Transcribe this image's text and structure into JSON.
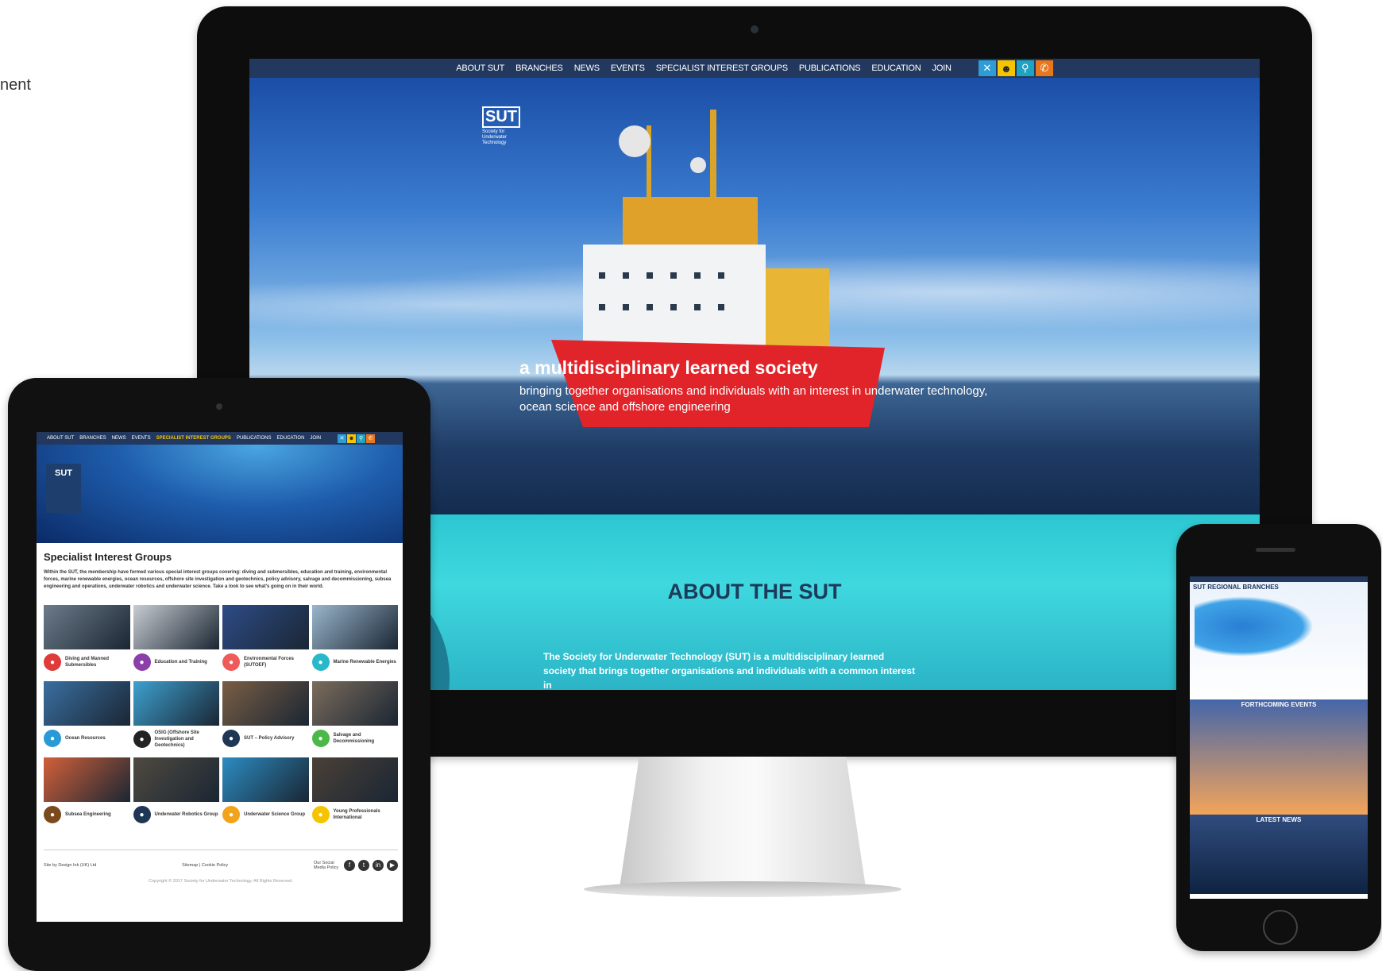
{
  "side_text": "nent",
  "imac": {
    "nav": [
      "ABOUT SUT",
      "BRANCHES",
      "NEWS",
      "EVENTS",
      "SPECIALIST INTEREST GROUPS",
      "PUBLICATIONS",
      "EDUCATION",
      "JOIN"
    ],
    "nav_icons": [
      {
        "name": "close-icon",
        "glyph": "✕",
        "color": "#2f9cd6"
      },
      {
        "name": "user-icon",
        "glyph": "👤",
        "color": "#f5c400"
      },
      {
        "name": "search-icon",
        "glyph": "🔍",
        "color": "#1fa3c2"
      },
      {
        "name": "phone-icon",
        "glyph": "✆",
        "color": "#e8771c"
      }
    ],
    "logo_mark": "SUT",
    "logo_tag": "Society for Underwater Technology",
    "hero_title": "a multidisciplinary learned society",
    "hero_sub": "bringing together organisations and individuals with an interest in underwater technology, ocean science and offshore engineering",
    "about_title": "ABOUT THE SUT",
    "about_text": "The Society for Underwater Technology (SUT) is a multidisciplinary learned society that brings together organisations and individuals with a common interest in"
  },
  "ipad": {
    "nav": [
      "ABOUT SUT",
      "BRANCHES",
      "NEWS",
      "EVENTS",
      "SPECIALIST INTEREST GROUPS",
      "PUBLICATIONS",
      "EDUCATION",
      "JOIN"
    ],
    "logo_mark": "SUT",
    "title": "Specialist Interest Groups",
    "intro": "Within the SUT, the membership have formed various special interest groups covering: diving and submersibles, education and training, environmental forces, marine renewable energies, ocean resources, offshore site investigation and geotechnics, policy advisory, salvage and decommissioning, subsea engineering and operations, underwater robotics and underwater science. Take a look to see what's going on in their world.",
    "groups": [
      {
        "label": "Diving and Manned Submersibles",
        "color": "#e03b3b",
        "thumb": "#6d7b8a"
      },
      {
        "label": "Education and Training",
        "color": "#8b3fa8",
        "thumb": "#c8ccd2"
      },
      {
        "label": "Environmental Forces (SUTOEF)",
        "color": "#ef5b5b",
        "thumb": "#2d4b86"
      },
      {
        "label": "Marine Renewable Energies",
        "color": "#29b8c9",
        "thumb": "#9ab6cc"
      },
      {
        "label": "Ocean Resources",
        "color": "#2a9ad6",
        "thumb": "#3a6fa1"
      },
      {
        "label": "OSIG (Offshore Site Investigation and Geotechnics)",
        "color": "#222222",
        "thumb": "#3ea0d0"
      },
      {
        "label": "SUT – Policy Advisory",
        "color": "#1f3655",
        "thumb": "#7a5e45"
      },
      {
        "label": "Salvage and Decommissioning",
        "color": "#4bb848",
        "thumb": "#7c6c5c"
      },
      {
        "label": "Subsea Engineering",
        "color": "#7a4a1e",
        "thumb": "#d2603a"
      },
      {
        "label": "Underwater Robotics Group",
        "color": "#1f3655",
        "thumb": "#4f4a40"
      },
      {
        "label": "Underwater Science Group",
        "color": "#f2a31c",
        "thumb": "#2c8cc2"
      },
      {
        "label": "Young Professionals International",
        "color": "#f5c400",
        "thumb": "#4b4038"
      }
    ],
    "footer_left": "Site by Design Ink (UK) Ltd",
    "footer_mid": "Sitemap | Cookie Policy",
    "footer_social_label": "Our Social Media Policy",
    "social_icons": [
      "facebook-icon",
      "twitter-icon",
      "linkedin-icon",
      "youtube-icon"
    ],
    "copyright": "Copyright © 2017 Society for Underwater Technology. All Rights Reserved."
  },
  "iphone": {
    "branches_title": "SUT REGIONAL BRANCHES",
    "events_title": "FORTHCOMING EVENTS",
    "news_title": "LATEST NEWS"
  }
}
